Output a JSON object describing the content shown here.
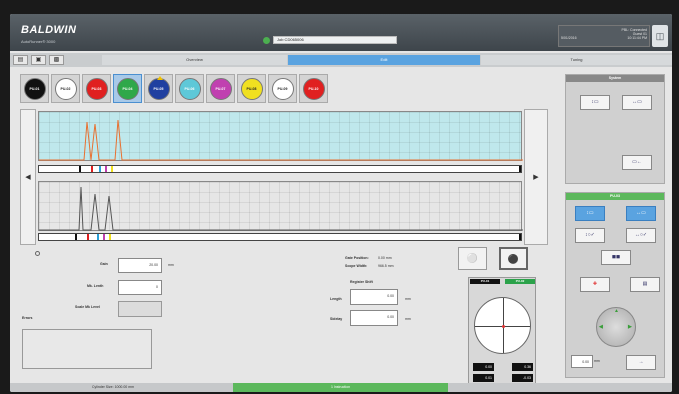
{
  "header": {
    "brand": "BALDWIN",
    "product": "AutoRunner® 3000",
    "job_label": "Job CD065006",
    "status_line1": "PBL: Connected",
    "status_line2": "Guest 01",
    "status_time": "10:11:44 PM",
    "status_date": "5/01/2016"
  },
  "tabs": [
    {
      "label": "Overview",
      "active": false
    },
    {
      "label": "Edit",
      "active": true
    },
    {
      "label": "Tuning",
      "active": false
    }
  ],
  "inks": [
    {
      "label": "PU-01",
      "color": "#111111",
      "text": "#ffffff"
    },
    {
      "label": "PU-02",
      "color": "#ffffff",
      "text": "#222222"
    },
    {
      "label": "PU-03",
      "color": "#e02020",
      "text": "#ffffff"
    },
    {
      "label": "PU-04",
      "color": "#2fa84a",
      "text": "#ffffff",
      "selected": true
    },
    {
      "label": "PU-05",
      "color": "#2040a0",
      "text": "#ffffff",
      "marker": true
    },
    {
      "label": "PU-06",
      "color": "#5ec8d8",
      "text": "#ffffff"
    },
    {
      "label": "PU-07",
      "color": "#c040b0",
      "text": "#ffffff"
    },
    {
      "label": "PU-08",
      "color": "#f0e020",
      "text": "#222222"
    },
    {
      "label": "PU-09",
      "color": "#ffffff",
      "text": "#222222"
    },
    {
      "label": "PU-10",
      "color": "#e02020",
      "text": "#ffffff"
    }
  ],
  "settings": {
    "gain_label": "Gain",
    "gain_value": "20.00",
    "gain_unit": "mm",
    "mark_length_label": "Mk. Lenth",
    "mark_length_value": "0",
    "scale_label": "Scale Mk Level",
    "errors_label": "Errors"
  },
  "position": {
    "gate_label": "Gate Position:",
    "gate_value": "0.00 mm",
    "scope_label": "Scope Width:",
    "scope_value": "966.5 mm",
    "register_shift_label": "Register Shift",
    "length_label": "Length",
    "length_value": "0.00",
    "length_unit": "mm",
    "sidelay_label": "Sidelay",
    "sidelay_value": "0.00",
    "sidelay_unit": "mm"
  },
  "register_panel": {
    "left_title": "PU-01",
    "right_title": "PU-02",
    "val_tl": "0.00",
    "val_tr": "0.36",
    "val_bl": "0.01",
    "val_br": "-0.03"
  },
  "right_panel": {
    "system_title": "System",
    "unit_title": "PU-03",
    "small_input": "0.00",
    "small_unit": "mm"
  },
  "footer": {
    "cylinder": "Cylinder Size: 1000.00 mm",
    "status": "1 Instruction"
  }
}
